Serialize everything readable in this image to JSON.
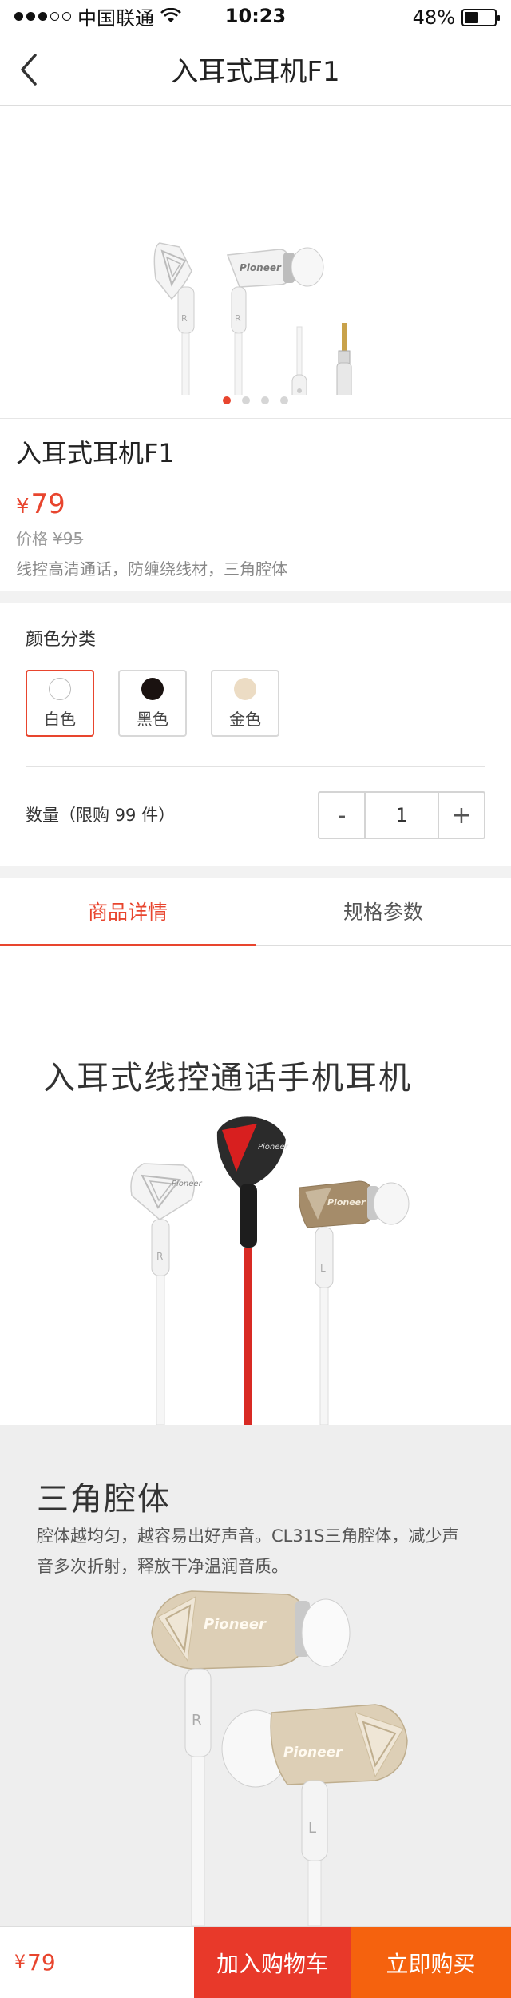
{
  "status_bar": {
    "carrier": "中国联通",
    "time": "10:23",
    "battery": "48%",
    "battery_level": 0.48
  },
  "nav": {
    "title": "入耳式耳机F1",
    "back_icon": "chevron-left-icon"
  },
  "carousel": {
    "slide_count": 4,
    "active_index": 0
  },
  "product": {
    "name": "入耳式耳机F1",
    "currency": "¥",
    "price": "79",
    "orig_label": "价格",
    "orig_price": "¥95",
    "features": "线控高清通话，防缠绕线材，三角腔体"
  },
  "options": {
    "color_label": "颜色分类",
    "colors": [
      {
        "label": "白色",
        "swatch": "#ffffff",
        "selected": true
      },
      {
        "label": "黑色",
        "swatch": "#1a1210",
        "selected": false
      },
      {
        "label": "金色",
        "swatch": "#ecdcc4",
        "selected": false
      }
    ],
    "quantity_label": "数量（限购 99 件）",
    "quantity": "1",
    "minus": "-",
    "plus": "+"
  },
  "tabs": [
    {
      "label": "商品详情",
      "active": true
    },
    {
      "label": "规格参数",
      "active": false
    }
  ],
  "details": {
    "heading_1": "入耳式线控通话手机耳机",
    "heading_2": "三角腔体",
    "text_2": "腔体越均匀，越容易出好声音。CL31S三角腔体，减少声音多次折射，释放干净温润音质。"
  },
  "bottom_bar": {
    "currency": "¥",
    "price": "79",
    "add_cart": "加入购物车",
    "buy_now": "立即购买"
  },
  "colors": {
    "accent": "#e8452e",
    "cart_button": "#e8392a",
    "buy_button": "#f5620e"
  }
}
